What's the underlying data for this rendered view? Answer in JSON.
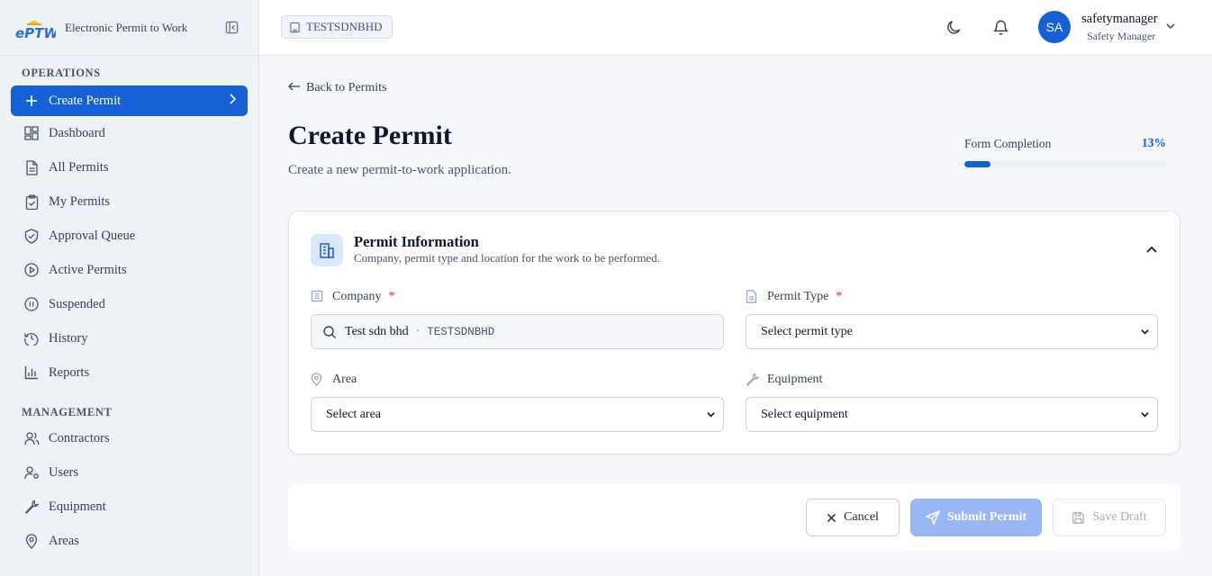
{
  "brand": {
    "logo_text": "ePTW",
    "title": "Electronic Permit to Work"
  },
  "sidebar": {
    "operations_label": "OPERATIONS",
    "management_label": "MANAGEMENT",
    "operations": [
      {
        "label": "Create Permit",
        "icon": "plus-icon"
      },
      {
        "label": "Dashboard",
        "icon": "dashboard-icon"
      },
      {
        "label": "All Permits",
        "icon": "document-icon"
      },
      {
        "label": "My Permits",
        "icon": "clipboard-check-icon"
      },
      {
        "label": "Approval Queue",
        "icon": "shield-check-icon"
      },
      {
        "label": "Active Permits",
        "icon": "play-circle-icon"
      },
      {
        "label": "Suspended",
        "icon": "pause-circle-icon"
      },
      {
        "label": "History",
        "icon": "history-icon"
      },
      {
        "label": "Reports",
        "icon": "bar-chart-icon"
      }
    ],
    "management": [
      {
        "label": "Contractors",
        "icon": "users-icon"
      },
      {
        "label": "Users",
        "icon": "user-cog-icon"
      },
      {
        "label": "Equipment",
        "icon": "wrench-icon"
      },
      {
        "label": "Areas",
        "icon": "map-pin-icon"
      }
    ]
  },
  "header": {
    "tenant": "TESTSDNBHD",
    "avatar_initials": "SA",
    "user_name": "safetymanager",
    "user_role": "Safety Manager"
  },
  "main": {
    "back_link": "Back to Permits",
    "title": "Create Permit",
    "subtitle": "Create a new permit-to-work application.",
    "completion_label": "Form Completion",
    "completion_pct_text": "13%",
    "completion_fraction": 0.13
  },
  "card": {
    "title": "Permit Information",
    "subtitle": "Company, permit type and location for the work to be performed.",
    "company_label": "Company",
    "company_name": "Test sdn bhd",
    "company_sep": "·",
    "company_code": "TESTSDNBHD",
    "permit_type_label": "Permit Type",
    "permit_type_placeholder": "Select permit type",
    "area_label": "Area",
    "area_placeholder": "Select area",
    "equipment_label": "Equipment",
    "equipment_placeholder": "Select equipment",
    "required_mark": "*"
  },
  "actions": {
    "cancel": "Cancel",
    "submit": "Submit Permit",
    "draft": "Save Draft"
  },
  "colors": {
    "primary": "#1560d4",
    "submit_disabled": "#98b7f5",
    "required": "#dc2626"
  }
}
